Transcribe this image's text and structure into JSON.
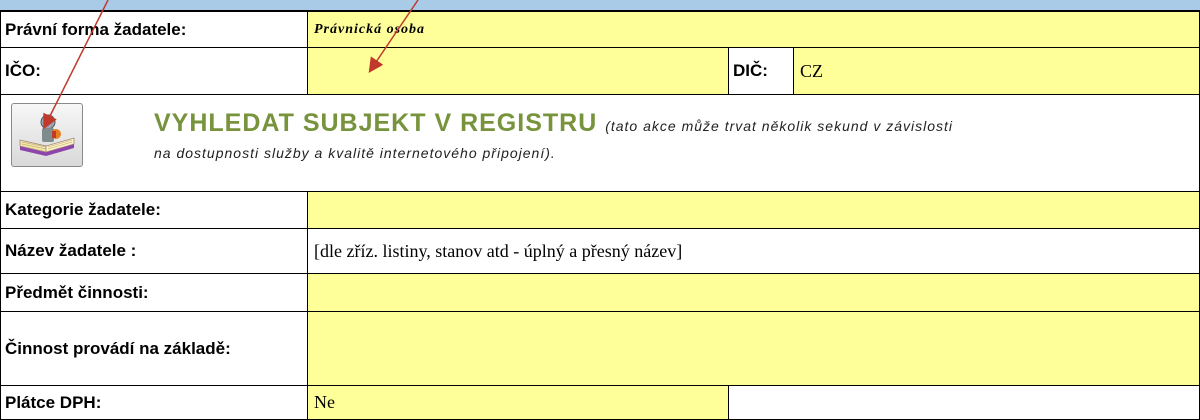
{
  "form": {
    "legal_form_label": "Právní forma žadatele:",
    "legal_form_value": "Právnická osoba",
    "ico_label": "IČO:",
    "ico_value": "",
    "dic_label": "DIČ:",
    "dic_value": "CZ",
    "search_title": "VYHLEDAT SUBJEKT V REGISTRU",
    "search_note_1": "(tato akce může trvat několik sekund v závislosti",
    "search_note_2": "na dostupnosti služby a kvalitě internetového připojení).",
    "category_label": "Kategorie žadatele:",
    "category_value": "",
    "name_label": "Název žadatele :",
    "name_value": "[dle zříz. listiny, stanov atd - úplný a přesný název]",
    "activity_label": "Předmět činnosti:",
    "activity_value": "",
    "basis_label": "Činnost provádí na základě:",
    "basis_value": "",
    "vat_label": "Plátce DPH:",
    "vat_value": "Ne"
  },
  "icons": {
    "search_button_icon": "book-search-icon"
  },
  "colors": {
    "input_bg": "#ffff99",
    "search_title": "#77933c",
    "arrow": "#c0392b",
    "topbar": "#a9cbe8"
  }
}
